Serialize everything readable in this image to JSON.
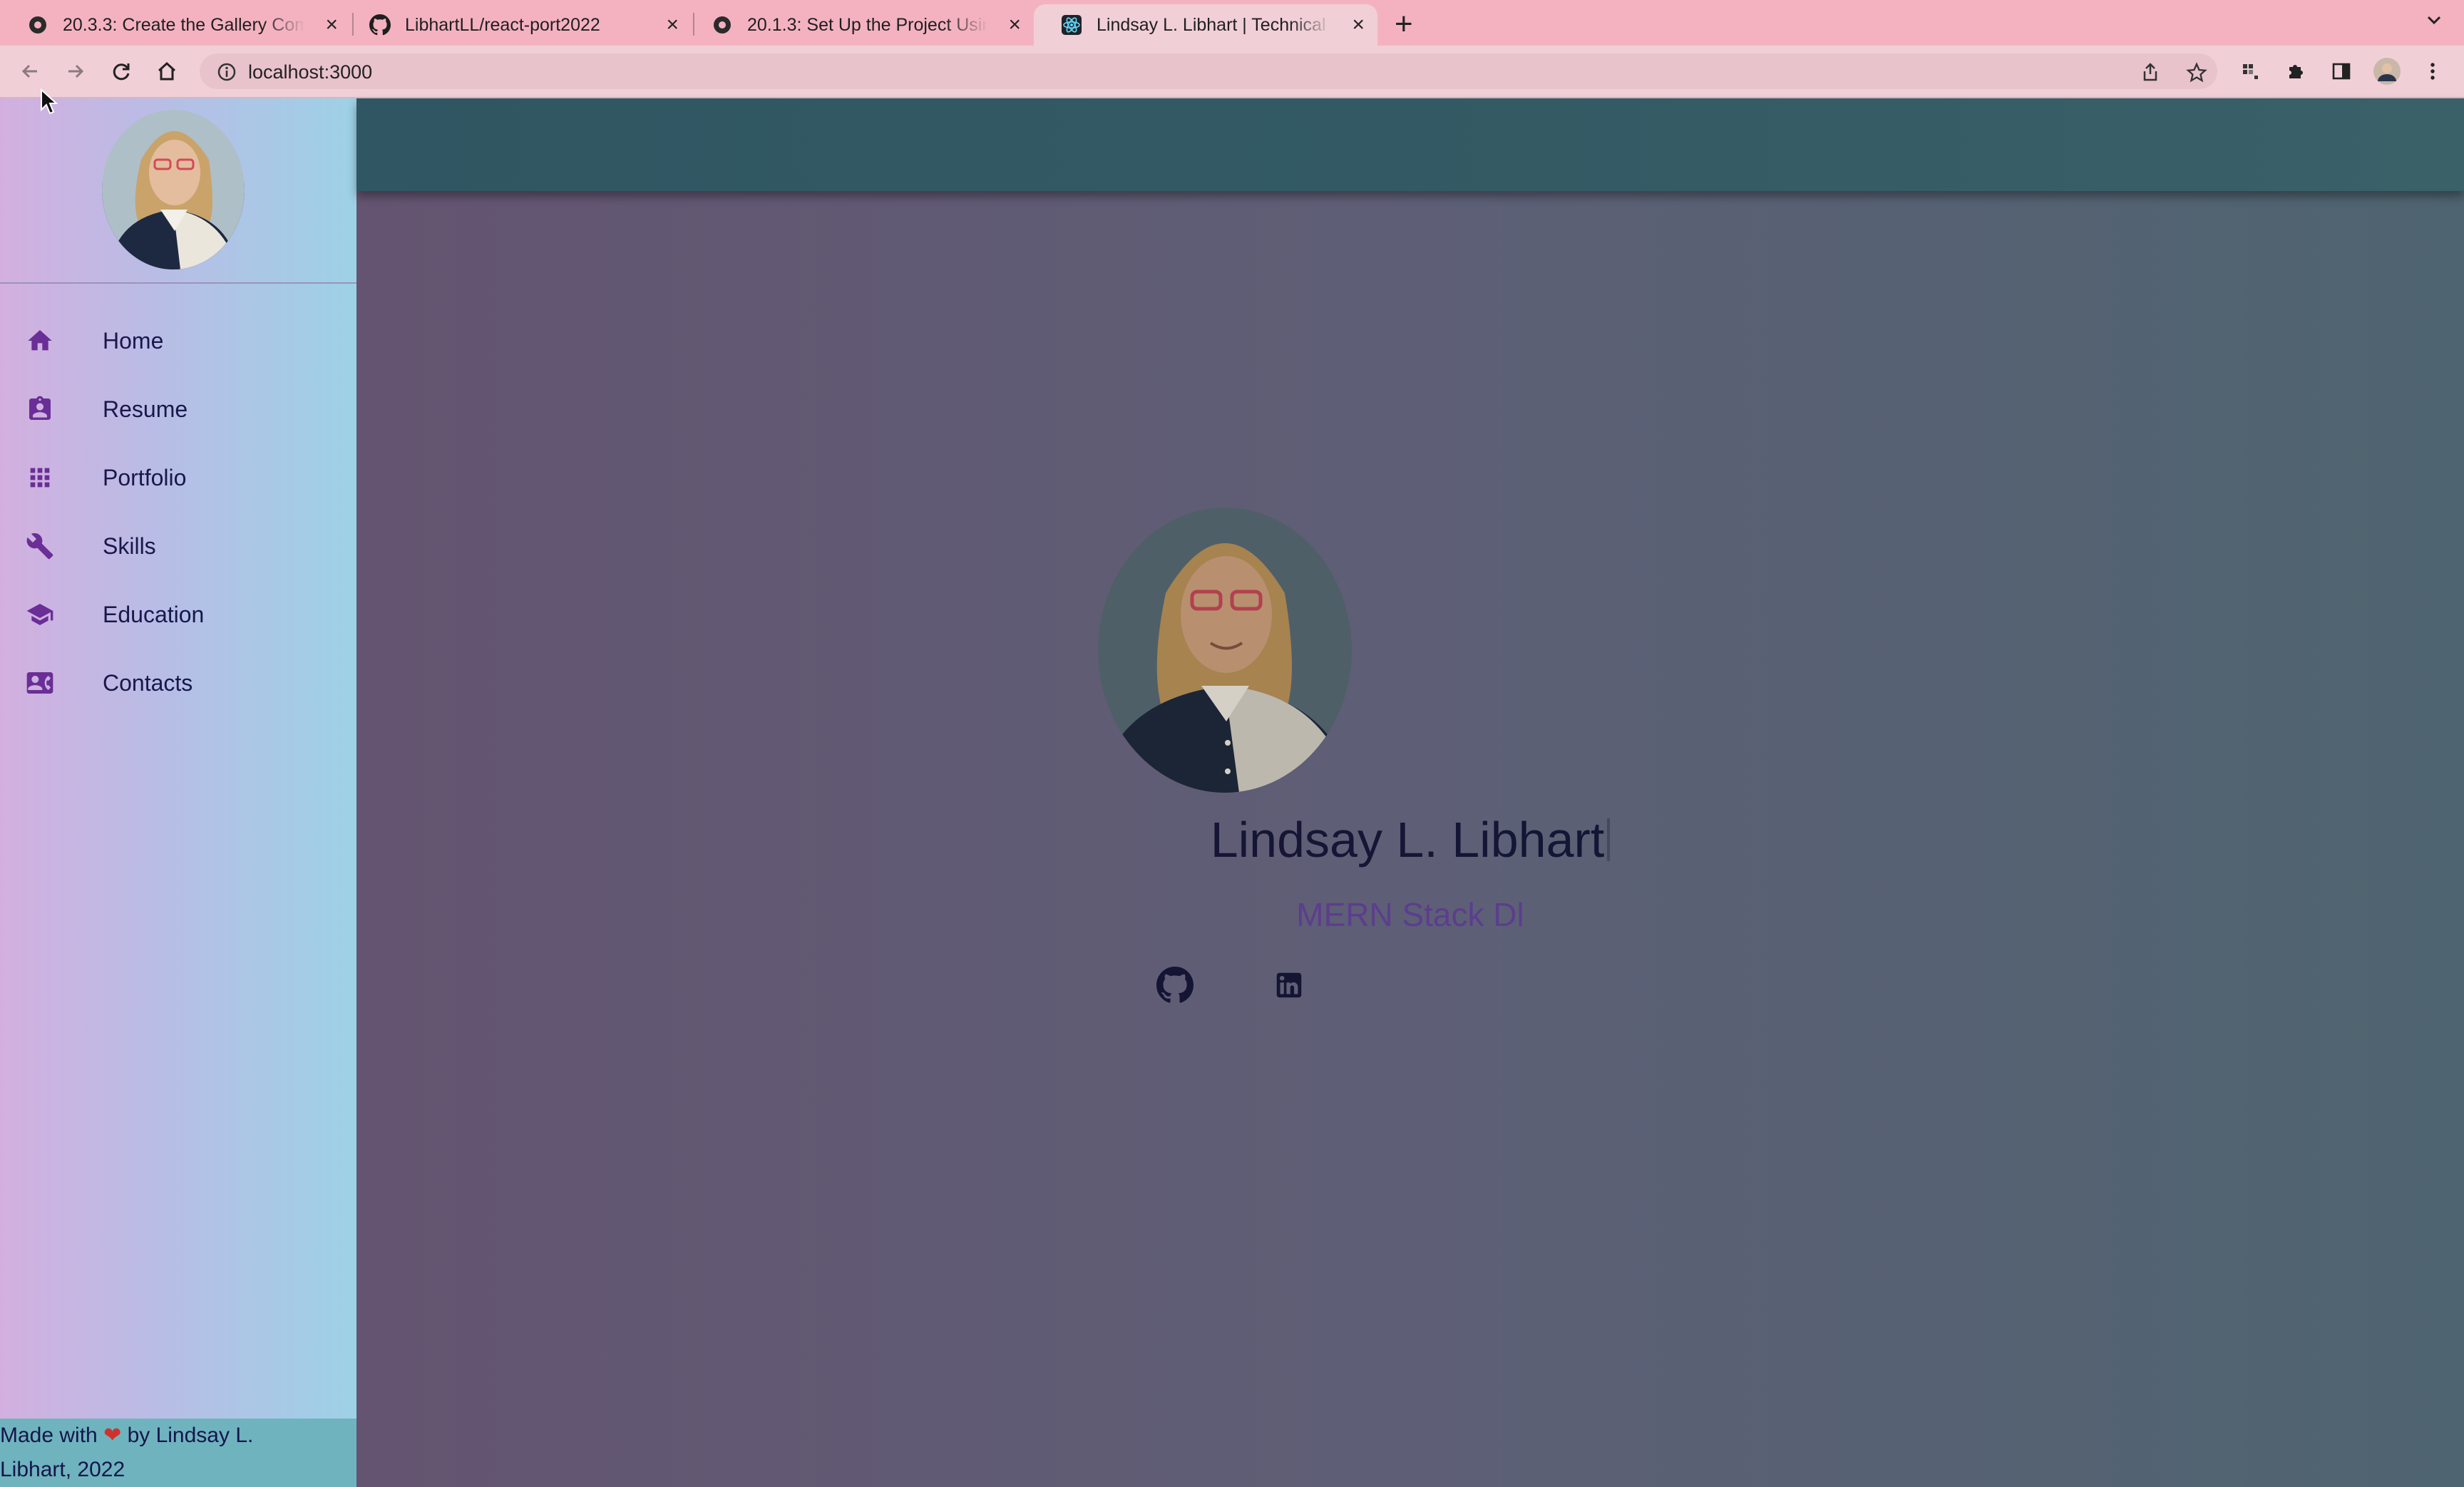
{
  "browser": {
    "tabs": [
      {
        "title": "20.3.3: Create the Gallery Com",
        "icon": "canvas-icon",
        "active": false
      },
      {
        "title": "LibhartLL/react-port2022",
        "icon": "github-icon",
        "active": false
      },
      {
        "title": "20.1.3: Set Up the Project Usin",
        "icon": "canvas-icon",
        "active": false
      },
      {
        "title": "Lindsay L. Libhart | Technical S",
        "icon": "react-icon",
        "active": true
      }
    ],
    "url": "localhost:3000"
  },
  "sidebar": {
    "items": [
      {
        "label": "Home",
        "icon": "home-icon"
      },
      {
        "label": "Resume",
        "icon": "resume-icon"
      },
      {
        "label": "Portfolio",
        "icon": "grid-icon"
      },
      {
        "label": "Skills",
        "icon": "wrench-icon"
      },
      {
        "label": "Education",
        "icon": "school-icon"
      },
      {
        "label": "Contacts",
        "icon": "contact-card-icon"
      }
    ],
    "footer": {
      "prefix": "Made with",
      "suffix": "by Lindsay L.",
      "line2": "Libhart, 2022"
    }
  },
  "hero": {
    "name": "Lindsay L. Libhart",
    "subtitle": "MERN Stack Dl",
    "socials": [
      {
        "icon": "github-icon"
      },
      {
        "icon": "linkedin-icon"
      }
    ]
  },
  "colors": {
    "tabbar": "#f4b2c1",
    "toolbar": "#f1cfd6",
    "sidebar_left": "#d3afdf",
    "sidebar_right": "#9dd1e6",
    "topbar": "#335a64",
    "accent": "#5c3d8e"
  }
}
